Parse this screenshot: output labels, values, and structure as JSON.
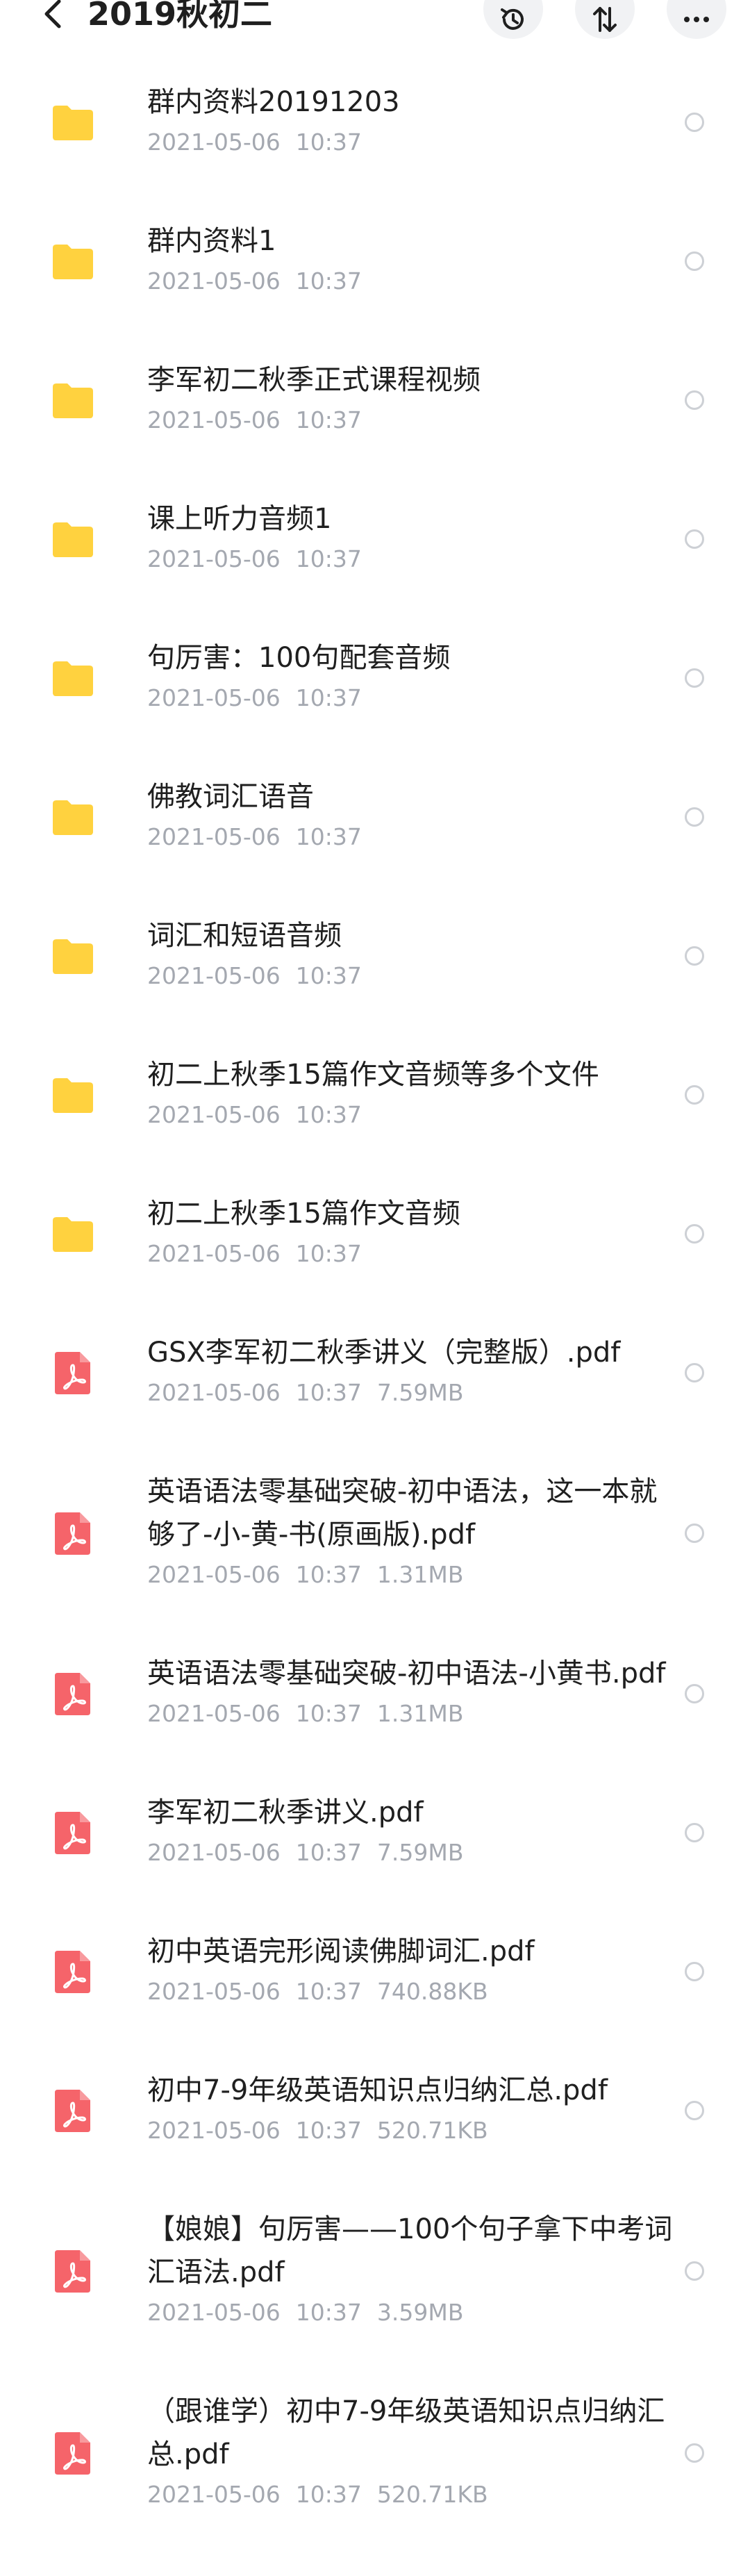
{
  "header": {
    "title": "2019秋初二",
    "back_icon": "chevron-left-icon",
    "actions": [
      "history-icon",
      "sort-icon",
      "more-icon"
    ]
  },
  "colors": {
    "folder": "#FFD23F",
    "pdf": "#F5646A",
    "meta_text": "#A4A8B0",
    "name_text": "#1F1F1F"
  },
  "files": [
    {
      "type": "folder",
      "name": "群内资料20191203",
      "date": "2021-05-06",
      "time": "10:37",
      "size": ""
    },
    {
      "type": "folder",
      "name": "群内资料1",
      "date": "2021-05-06",
      "time": "10:37",
      "size": ""
    },
    {
      "type": "folder",
      "name": "李军初二秋季正式课程视频",
      "date": "2021-05-06",
      "time": "10:37",
      "size": ""
    },
    {
      "type": "folder",
      "name": "课上听力音频1",
      "date": "2021-05-06",
      "time": "10:37",
      "size": ""
    },
    {
      "type": "folder",
      "name": "句厉害：100句配套音频",
      "date": "2021-05-06",
      "time": "10:37",
      "size": ""
    },
    {
      "type": "folder",
      "name": "佛教词汇语音",
      "date": "2021-05-06",
      "time": "10:37",
      "size": ""
    },
    {
      "type": "folder",
      "name": "词汇和短语音频",
      "date": "2021-05-06",
      "time": "10:37",
      "size": ""
    },
    {
      "type": "folder",
      "name": "初二上秋季15篇作文音频等多个文件",
      "date": "2021-05-06",
      "time": "10:37",
      "size": ""
    },
    {
      "type": "folder",
      "name": "初二上秋季15篇作文音频",
      "date": "2021-05-06",
      "time": "10:37",
      "size": ""
    },
    {
      "type": "pdf",
      "name": "GSX李军初二秋季讲义（完整版）.pdf",
      "date": "2021-05-06",
      "time": "10:37",
      "size": "7.59MB"
    },
    {
      "type": "pdf",
      "name": "英语语法零基础突破-初中语法，这一本就够了-小-黄-书(原画版).pdf",
      "date": "2021-05-06",
      "time": "10:37",
      "size": "1.31MB"
    },
    {
      "type": "pdf",
      "name": "英语语法零基础突破-初中语法-小黄书.pdf",
      "date": "2021-05-06",
      "time": "10:37",
      "size": "1.31MB"
    },
    {
      "type": "pdf",
      "name": "李军初二秋季讲义.pdf",
      "date": "2021-05-06",
      "time": "10:37",
      "size": "7.59MB"
    },
    {
      "type": "pdf",
      "name": "初中英语完形阅读佛脚词汇.pdf",
      "date": "2021-05-06",
      "time": "10:37",
      "size": "740.88KB"
    },
    {
      "type": "pdf",
      "name": "初中7-9年级英语知识点归纳汇总.pdf",
      "date": "2021-05-06",
      "time": "10:37",
      "size": "520.71KB"
    },
    {
      "type": "pdf",
      "name": "【娘娘】句厉害——100个句子拿下中考词汇语法.pdf",
      "date": "2021-05-06",
      "time": "10:37",
      "size": "3.59MB"
    },
    {
      "type": "pdf",
      "name": "（跟谁学）初中7-9年级英语知识点归纳汇总.pdf",
      "date": "2021-05-06",
      "time": "10:37",
      "size": "520.71KB"
    }
  ]
}
